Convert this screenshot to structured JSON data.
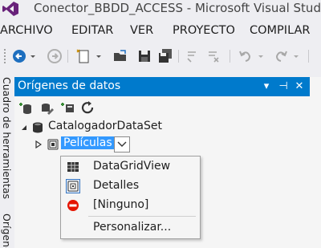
{
  "window": {
    "title": "Conector_BBDD_ACCESS - Microsoft Visual Studio"
  },
  "menu": {
    "items": [
      "ARCHIVO",
      "EDITAR",
      "VER",
      "PROYECTO",
      "COMPILAR"
    ]
  },
  "side_tabs": {
    "toolbox": "Cuadro de herramientas",
    "datasources": "Orígenes"
  },
  "panel": {
    "title": "Orígenes de datos",
    "header_buttons": {
      "dropdown": "▾",
      "pin": "⊣",
      "close": "✕"
    }
  },
  "tree": {
    "dataset": "CatalogadorDataSet",
    "table": "Películas"
  },
  "dropdown": {
    "items": [
      "DataGridView",
      "Detalles",
      "[Ninguno]",
      "Personalizar..."
    ]
  },
  "colors": {
    "accent": "#007acc",
    "selection": "#3399ff",
    "none_icon": "#e51400",
    "vs_purple": "#68217a"
  }
}
